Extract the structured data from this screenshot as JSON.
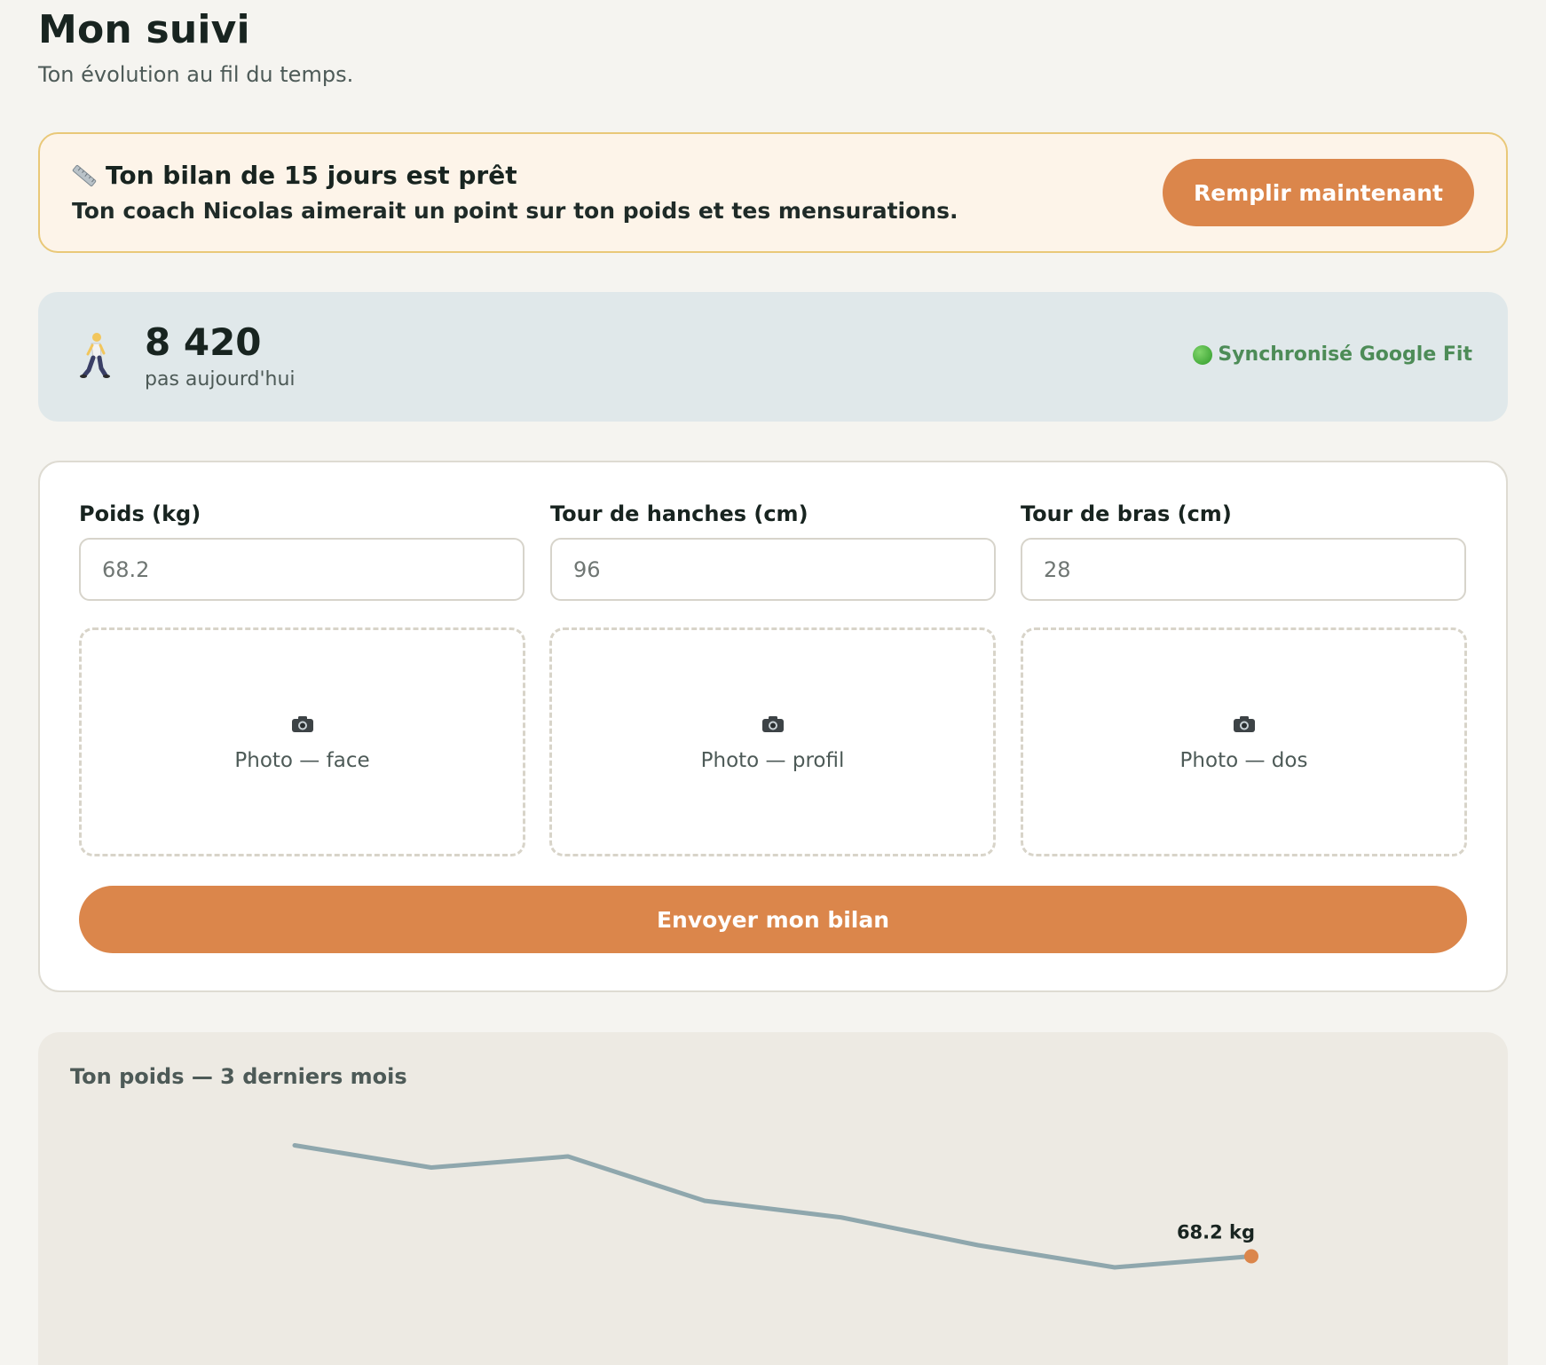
{
  "page": {
    "title": "Mon suivi",
    "subtitle": "Ton évolution au fil du temps."
  },
  "alert": {
    "icon": "ruler-icon",
    "title": "Ton bilan de 15 jours est prêt",
    "text": "Ton coach Nicolas aimerait un point sur ton poids et tes mensurations.",
    "button_label": "Remplir maintenant"
  },
  "steps": {
    "icon": "walking-person-icon",
    "value": "8 420",
    "label": "pas aujourd'hui",
    "sync_icon": "green-circle-icon",
    "sync_label": "Synchronisé Google Fit"
  },
  "form": {
    "fields": [
      {
        "label": "Poids (kg)",
        "placeholder": "68.2"
      },
      {
        "label": "Tour de hanches (cm)",
        "placeholder": "96"
      },
      {
        "label": "Tour de bras (cm)",
        "placeholder": "28"
      }
    ],
    "photos": [
      {
        "icon": "camera-icon",
        "label": "Photo — face"
      },
      {
        "icon": "camera-icon",
        "label": "Photo — profil"
      },
      {
        "icon": "camera-icon",
        "label": "Photo — dos"
      }
    ],
    "submit_label": "Envoyer mon bilan"
  },
  "colors": {
    "accent": "#db864b",
    "line": "#8fa7ad",
    "sync_green": "#4d8c57"
  },
  "chart_data": {
    "type": "line",
    "title": "Ton poids — 3 derniers mois",
    "xlabel": "",
    "ylabel": "",
    "series": [
      {
        "values": [
          70.9,
          70.5,
          70.7,
          69.9,
          69.6,
          69.1,
          68.7,
          68.9
        ]
      }
    ],
    "ylim": [
      67.5,
      71.5
    ],
    "grid": false,
    "annotations": [
      {
        "index": 7,
        "text": "68.2 kg"
      }
    ]
  }
}
